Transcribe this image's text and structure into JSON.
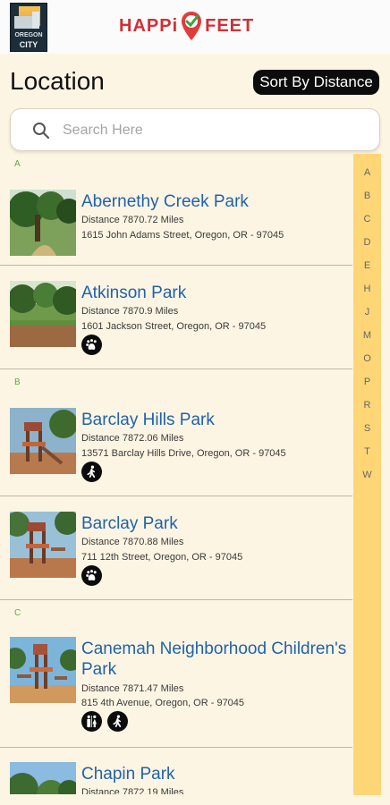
{
  "header": {
    "city_logo": {
      "top_text": "OREGON",
      "bottom_text": "CITY",
      "icon": "oregon-city-logo"
    },
    "brand": {
      "part1": "HAPPi",
      "part2": "FEET",
      "icon": "location-pin-check-icon"
    }
  },
  "page": {
    "title": "Location",
    "sort_label": "Sort By Distance"
  },
  "search": {
    "placeholder": "Search Here",
    "icon": "search-icon"
  },
  "sections": [
    {
      "letter": "A",
      "parks": [
        {
          "name": "Abernethy Creek Park",
          "distance": "Distance  7870.72 Miles",
          "address": "1615 John Adams Street, Oregon, OR - 97045",
          "amenities": []
        },
        {
          "name": "Atkinson Park",
          "distance": "Distance  7870.9 Miles",
          "address": "1601 Jackson Street, Oregon, OR - 97045",
          "amenities": [
            "dog-icon"
          ]
        }
      ]
    },
    {
      "letter": "B",
      "parks": [
        {
          "name": "Barclay Hills Park",
          "distance": "Distance  7872.06 Miles",
          "address": "13571 Barclay Hills Drive, Oregon, OR - 97045",
          "amenities": [
            "walking-icon"
          ]
        },
        {
          "name": "Barclay Park",
          "distance": "Distance  7870.88 Miles",
          "address": "711 12th Street, Oregon, OR - 97045",
          "amenities": [
            "dog-icon"
          ]
        }
      ]
    },
    {
      "letter": "C",
      "parks": [
        {
          "name": "Canemah Neighborhood Children's Park",
          "distance": "Distance  7871.47 Miles",
          "address": "815 4th Avenue, Oregon, OR - 97045",
          "amenities": [
            "restroom-icon",
            "walking-icon"
          ]
        },
        {
          "name": "Chapin Park",
          "distance": "Distance  7872.19 Miles",
          "address": "",
          "amenities": []
        }
      ]
    }
  ],
  "index_letters": [
    "A",
    "B",
    "C",
    "D",
    "E",
    "H",
    "J",
    "M",
    "O",
    "P",
    "R",
    "S",
    "T",
    "W"
  ],
  "colors": {
    "accent_red": "#d32f35",
    "park_title": "#1f62ad",
    "section_letter": "#5fae3f",
    "index_bar": "#fed676",
    "background": "#fdf5e3"
  }
}
